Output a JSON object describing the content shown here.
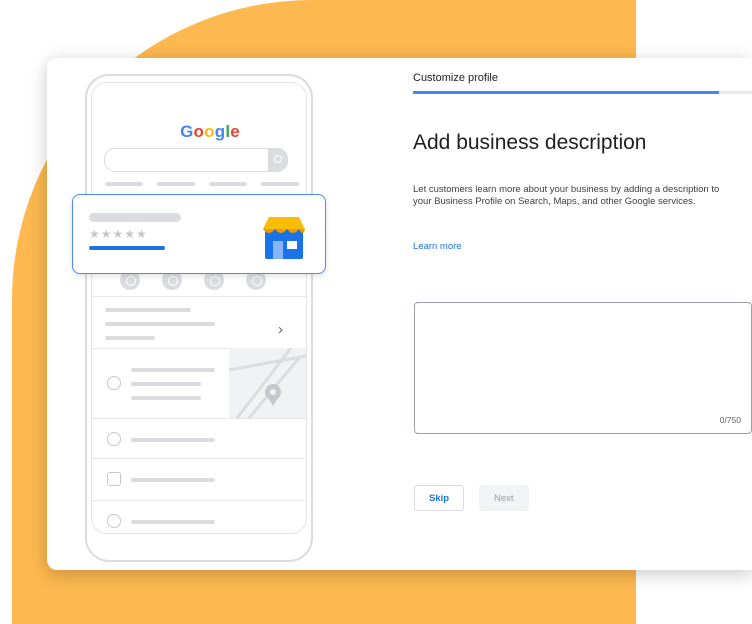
{
  "wizard": {
    "breadcrumb": "Customize profile",
    "progress": 0.9,
    "title": "Add business description",
    "description": "Let customers learn more about your business by adding a description to your Business Profile on Search, Maps, and other Google services.",
    "learn_more": "Learn more",
    "description_value": "",
    "char_count": "0/750",
    "skip_label": "Skip",
    "next_label": "Next"
  },
  "illustration": {
    "logo_letters": [
      "G",
      "o",
      "o",
      "g",
      "l",
      "e"
    ],
    "logo_colors": [
      "#4285f4",
      "#ea4335",
      "#fbbc05",
      "#4285f4",
      "#34a853",
      "#ea4335"
    ],
    "rating_stars": "★★★★★",
    "chevron": "›"
  },
  "colors": {
    "accent": "#1a73e8",
    "background_shape": "#fdb84f"
  }
}
